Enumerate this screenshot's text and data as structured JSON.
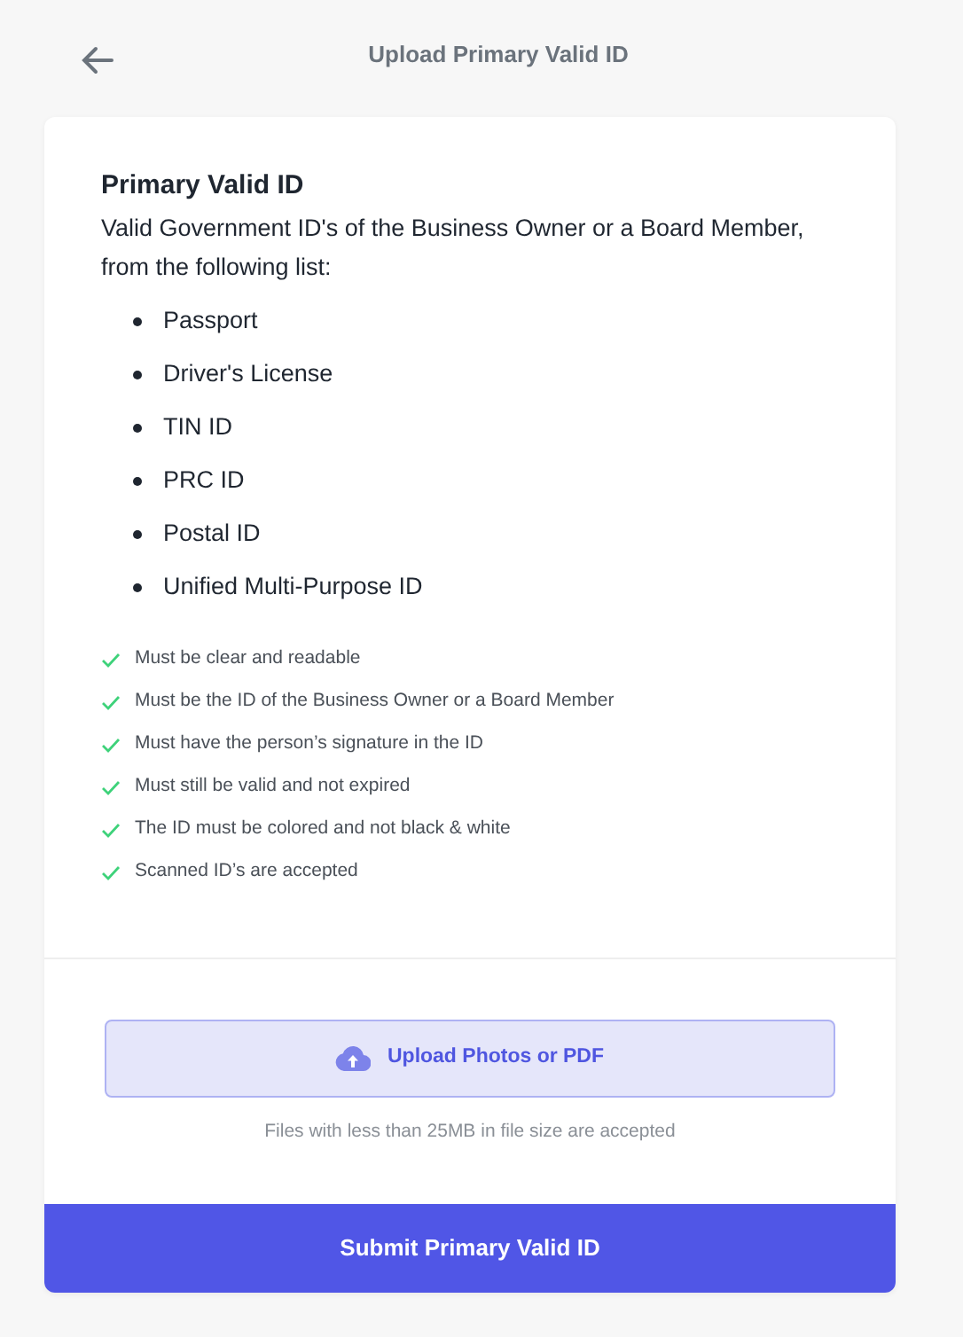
{
  "header": {
    "title": "Upload Primary Valid ID"
  },
  "card": {
    "heading": "Primary Valid ID",
    "description": "Valid Government ID's of the Business Owner or a Board Member, from the following list:",
    "id_types": [
      "Passport",
      "Driver's License",
      "TIN ID",
      "PRC ID",
      "Postal ID",
      "Unified Multi-Purpose ID"
    ],
    "requirements": [
      "Must be clear and readable",
      "Must be the ID of the Business Owner or a Board Member",
      "Must have the person’s signature in the ID",
      "Must still be valid and not expired",
      "The ID must be colored and not black & white",
      "Scanned ID’s are accepted"
    ],
    "upload_button": "Upload Photos or PDF",
    "upload_note": "Files with less than 25MB in file size are accepted",
    "submit_button": "Submit Primary Valid ID"
  }
}
